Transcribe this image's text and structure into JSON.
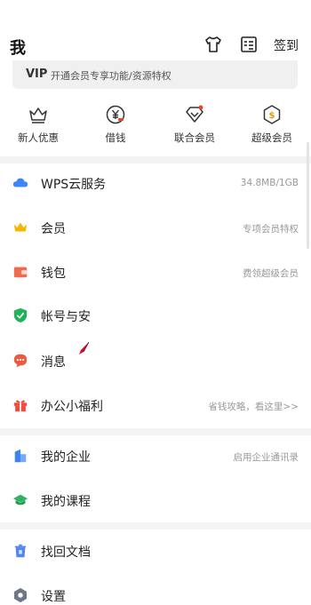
{
  "header": {
    "title": "我",
    "checkin_label": "签到",
    "icons": [
      "tshirt-icon",
      "list-icon"
    ]
  },
  "vip_banner": {
    "label": "VIP",
    "description": "开通会员专享功能/资源特权"
  },
  "quick_actions": [
    {
      "label": "新人优惠",
      "icon": "crown-icon"
    },
    {
      "label": "借钱",
      "icon": "yuan-icon"
    },
    {
      "label": "联合会员",
      "icon": "heart-badge-icon"
    },
    {
      "label": "超级会员",
      "icon": "hexagon-dollar-icon"
    }
  ],
  "menu": {
    "cloud": {
      "label": "WPS云服务",
      "hint": "34.8MB/1GB",
      "icon": "cloud-icon"
    },
    "member": {
      "label": "会员",
      "hint": "专项会员特权",
      "icon": "crown-icon"
    },
    "wallet": {
      "label": "钱包",
      "hint": "费领超级会员",
      "icon": "wallet-icon"
    },
    "account": {
      "label": "帐号与安",
      "hint": "",
      "icon": "shield-icon"
    },
    "messages": {
      "label": "消息",
      "hint": "",
      "icon": "chat-icon"
    },
    "welfare": {
      "label": "办公小福利",
      "hint": "省钱攻略，看这里>>",
      "icon": "gift-icon"
    },
    "enterprise": {
      "label": "我的企业",
      "hint": "启用企业通讯录",
      "icon": "building-icon"
    },
    "courses": {
      "label": "我的课程",
      "hint": "",
      "icon": "graduation-icon"
    },
    "recover": {
      "label": "找回文档",
      "hint": "",
      "icon": "trash-icon"
    },
    "settings": {
      "label": "设置",
      "hint": "",
      "icon": "gear-icon"
    }
  },
  "colors": {
    "cloud": "#3e86f5",
    "crown": "#f5b600",
    "wallet": "#f06a4d",
    "shield": "#23b15c",
    "chat": "#ec5b3f",
    "gift": "#ef4a3c",
    "enterprise": "#3f83f0",
    "courses": "#2db266",
    "recover": "#4f86f0",
    "settings": "#6e7788",
    "accent_red": "#e8432c"
  }
}
